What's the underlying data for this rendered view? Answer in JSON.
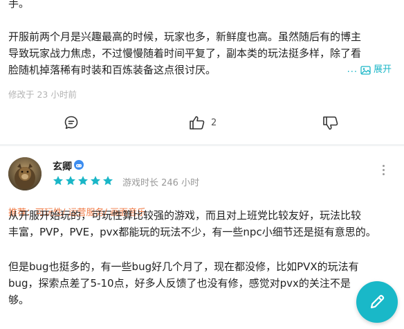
{
  "review1": {
    "lines": [
      "手。",
      "开服前两个月是兴趣最高的时候，玩家也多，新鲜度也高。虽然随后有的博主",
      "导致玩家战力焦虑，不过慢慢随着时间平复了，副本类的玩法挺多样，除了看",
      "脸随机掉落稀有时装和百炼装备这点很讨厌。"
    ],
    "expand_dots": "...",
    "expand_label": "展开",
    "modified": "修改于 23 小时前",
    "actions": {
      "like_count": "2"
    }
  },
  "review2": {
    "username": "玄卿",
    "rating": 5,
    "playtime": "游戏时长 246 小时",
    "recommend": "推荐：可玩性/ 运营服务/ 画面音乐",
    "paragraph1": [
      "从开服开始玩的，可玩性算比较强的游戏，而且对上班党比较友好，玩法比较",
      "丰富，PVP，PVE，pvx都能玩的玩法不少，有一些npc小细节还是挺有意思的。"
    ],
    "paragraph2": [
      "但是bug也挺多的，有一些bug好几个月了，现在都没修，比如PVX的玩法有",
      "bug，探索点差了5-10点，好多人反馈了也没有修，感觉对pvx的关注不是",
      "够。"
    ]
  },
  "colors": {
    "accent": "#19b8c8",
    "star": "#1ab6c7",
    "recommend": "#f07a45",
    "muted": "#b3b3b3"
  }
}
